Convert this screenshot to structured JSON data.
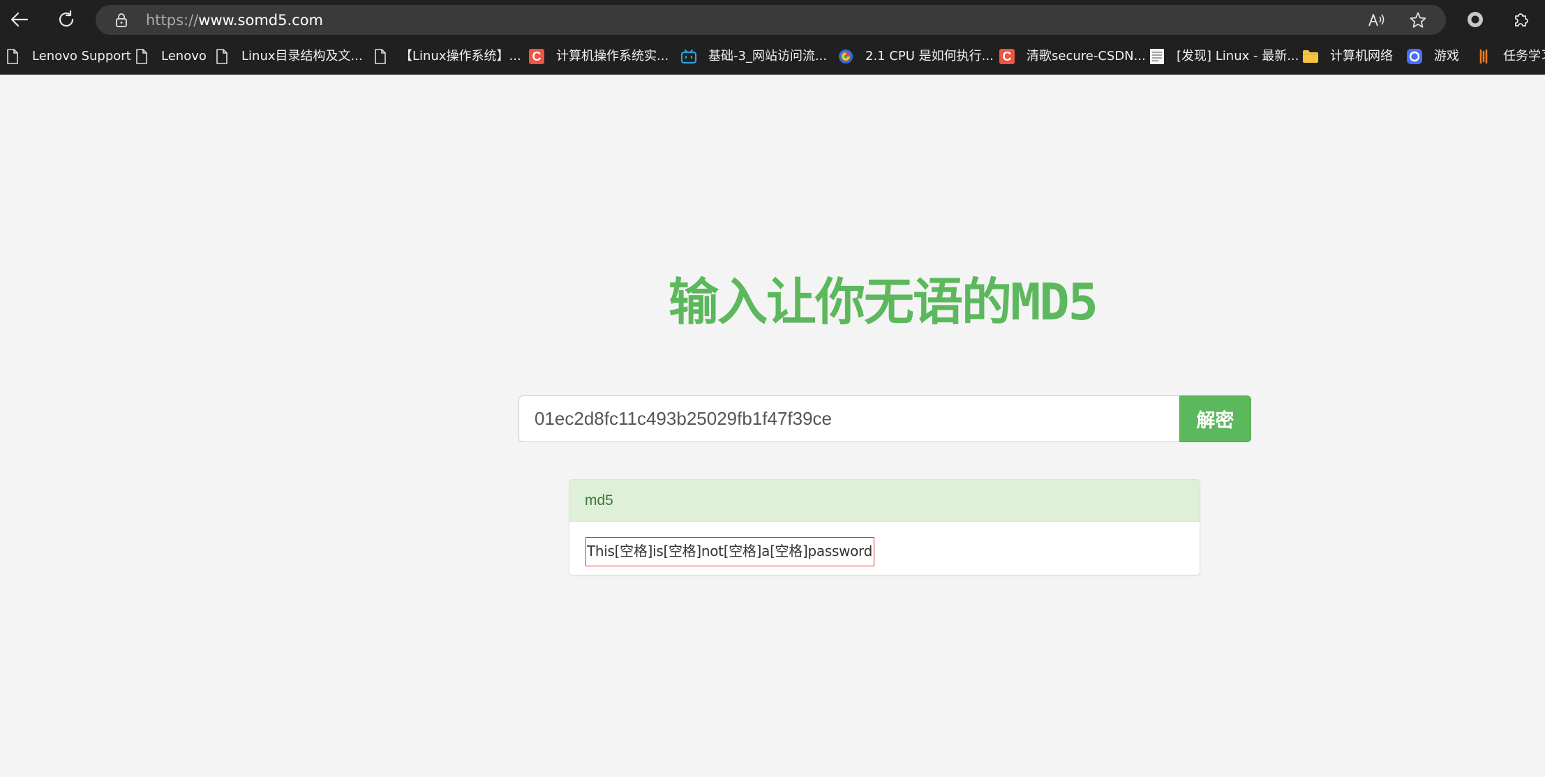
{
  "browser": {
    "address_scheme": "https://",
    "address_host": "www.somd5.com",
    "icons": {
      "back": "back-arrow-icon",
      "refresh": "refresh-icon",
      "lock": "lock-icon",
      "read_aloud": "read-aloud-icon",
      "favorite": "star-icon",
      "profile": "circle-icon",
      "extensions": "puzzle-icon"
    }
  },
  "bookmarks": [
    {
      "label": "Lenovo Support",
      "icon": "page-icon"
    },
    {
      "label": "Lenovo",
      "icon": "page-icon"
    },
    {
      "label": "Linux目录结构及文...",
      "icon": "page-icon"
    },
    {
      "label": "【Linux操作系统】...",
      "icon": "page-icon"
    },
    {
      "label": "计算机操作系统实...",
      "icon": "csdn-c-icon"
    },
    {
      "label": "基础-3_网站访问流...",
      "icon": "bilibili-tv-icon"
    },
    {
      "label": "2.1 CPU 是如何执行...",
      "icon": "colorful-logo-icon"
    },
    {
      "label": "清歌secure-CSDN...",
      "icon": "csdn-c-icon"
    },
    {
      "label": "[发现] Linux - 最新...",
      "icon": "document-icon"
    },
    {
      "label": "计算机网络",
      "icon": "folder-icon"
    },
    {
      "label": "游戏",
      "icon": "blue-app-icon"
    },
    {
      "label": "任务学习",
      "icon": "orange-app-icon"
    }
  ],
  "page": {
    "heading": "输入让你无语的MD5",
    "search_value": "01ec2d8fc11c493b25029fb1f47f39ce",
    "decrypt_label": "解密",
    "result_header": "md5",
    "result_value": "This[空格]is[空格]not[空格]a[空格]password"
  },
  "colors": {
    "accent_green": "#5cb85c",
    "panel_head_bg": "#dff0d8",
    "highlight_border": "#e03030",
    "browser_chrome": "#202020"
  }
}
